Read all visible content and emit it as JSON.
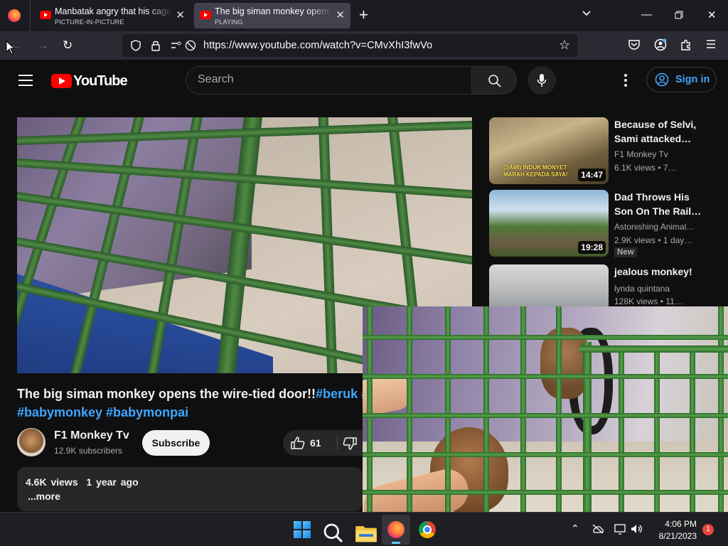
{
  "browser": {
    "tabs": [
      {
        "title": "Manbatak angry that his cage is",
        "subtitle": "PICTURE-IN-PICTURE",
        "active": false
      },
      {
        "title": "The big siman monkey opens the",
        "subtitle": "PLAYING",
        "active": true
      }
    ],
    "url": "https://www.youtube.com/watch?v=CMvXhI3fwVo"
  },
  "header": {
    "logo_text": "YouTube",
    "search_placeholder": "Search",
    "signin_label": "Sign in"
  },
  "video": {
    "title_main": "The big siman monkey opens the wire-tied door!!",
    "title_tags_inline": "#beruk #",
    "title_tags_line2": "#babymonkey #babymonpai",
    "channel_name": "F1 Monkey Tv",
    "channel_subs": "12.9K subscribers",
    "subscribe_label": "Subscribe",
    "like_count": "61",
    "views": "4.6K views",
    "age": "1 year ago",
    "more_label": "...more"
  },
  "related": [
    {
      "title": "Because of Selvi, Sami attacked…",
      "channel": "F1 Monkey Tv",
      "meta": "6.1K views  •  7…",
      "duration": "14:47",
      "badge": ""
    },
    {
      "title": "Dad Throws His Son On The Rail…",
      "channel": "Astonishing Animal…",
      "meta": "2.9K views  •  1 day…",
      "duration": "19:28",
      "badge": "New"
    },
    {
      "title": "jealous monkey!",
      "channel": "lynda quintana",
      "meta": "128K views  •  11…",
      "duration": "",
      "badge": ""
    }
  ],
  "thumb_captions": {
    "th1_caption": "(SAMI) INDUK MONYET MARAH KEPADA SAYA!"
  },
  "taskbar": {
    "time": "4:06 PM",
    "date": "8/21/2023",
    "notification_count": "1"
  },
  "colors": {
    "link_blue": "#3ea6ff",
    "youtube_red": "#ff0000",
    "background": "#0f0f0f"
  }
}
